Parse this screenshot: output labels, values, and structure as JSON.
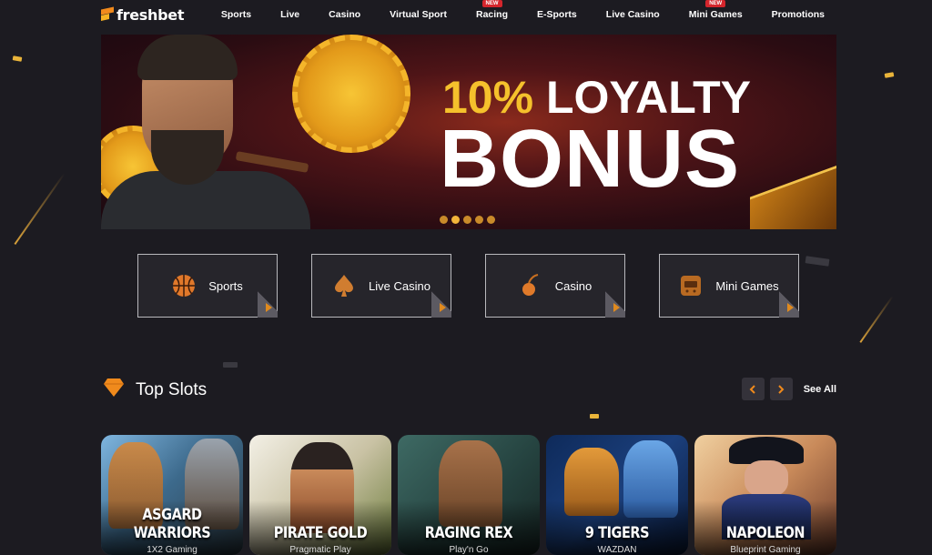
{
  "brand": {
    "name": "freshbet"
  },
  "nav": {
    "items": [
      {
        "label": "Sports",
        "badge": ""
      },
      {
        "label": "Live",
        "badge": ""
      },
      {
        "label": "Casino",
        "badge": ""
      },
      {
        "label": "Virtual Sport",
        "badge": ""
      },
      {
        "label": "Racing",
        "badge": "NEW"
      },
      {
        "label": "E-Sports",
        "badge": ""
      },
      {
        "label": "Live Casino",
        "badge": ""
      },
      {
        "label": "Mini Games",
        "badge": "NEW"
      },
      {
        "label": "Promotions",
        "badge": ""
      }
    ]
  },
  "banner": {
    "highlight": "10%",
    "title_line1": "LOYALTY",
    "title_line2": "BONUS",
    "slide_count": 5,
    "active_slide": 1
  },
  "categories": [
    {
      "label": "Sports",
      "icon": "basketball-icon"
    },
    {
      "label": "Live Casino",
      "icon": "spade-icon"
    },
    {
      "label": "Casino",
      "icon": "cherry-icon"
    },
    {
      "label": "Mini Games",
      "icon": "slot-machine-icon"
    }
  ],
  "top_slots": {
    "title": "Top Slots",
    "see_all": "See All",
    "items": [
      {
        "name": "ASGARD WARRIORS",
        "provider": "1X2 Gaming"
      },
      {
        "name": "PIRATE GOLD",
        "provider": "Pragmatic Play"
      },
      {
        "name": "RAGING REX",
        "provider": "Play'n Go"
      },
      {
        "name": "9 TIGERS",
        "provider": "WAZDAN"
      },
      {
        "name": "NAPOLEON",
        "provider": "Blueprint Gaming"
      }
    ]
  },
  "colors": {
    "accent": "#f08a1c",
    "gold": "#f5c12c",
    "background": "#1c1b21"
  }
}
